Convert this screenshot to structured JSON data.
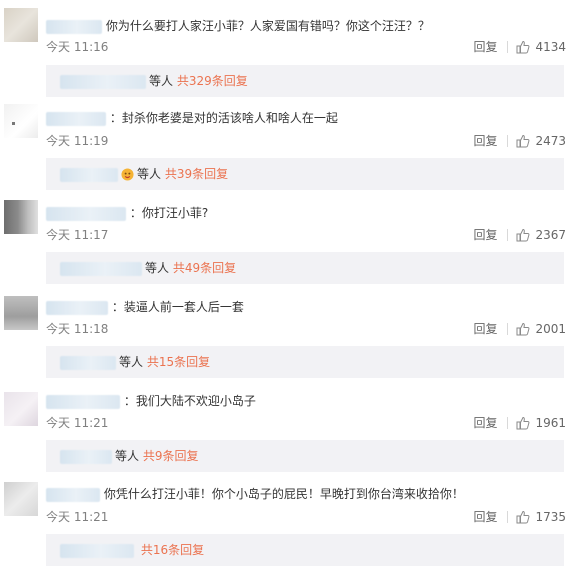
{
  "comments": [
    {
      "text": "你为什么要打人家汪小菲？人家爱国有错吗？你这个汪汪？？",
      "time": "今天 11:16",
      "reply_label": "回复",
      "likes": "4134",
      "sub_suffix": "等人",
      "sub_total": "共329条回复"
    },
    {
      "text": "：封杀你老婆是对的活该啥人和啥人在一起",
      "time": "今天 11:19",
      "reply_label": "回复",
      "likes": "2473",
      "sub_suffix": "等人",
      "sub_total": "共39条回复"
    },
    {
      "text": "：你打汪小菲?",
      "time": "今天 11:17",
      "reply_label": "回复",
      "likes": "2367",
      "sub_suffix": "等人",
      "sub_total": "共49条回复"
    },
    {
      "text": "：装逼人前一套人后一套",
      "time": "今天 11:18",
      "reply_label": "回复",
      "likes": "2001",
      "sub_suffix": "等人",
      "sub_total": "共15条回复"
    },
    {
      "text": "：我们大陆不欢迎小岛子",
      "time": "今天 11:21",
      "reply_label": "回复",
      "likes": "1961",
      "sub_suffix": "等人",
      "sub_total": "共9条回复"
    },
    {
      "text": "你凭什么打汪小菲！你个小岛子的屁民！早晚打到你台湾来收拾你！",
      "time": "今天 11:21",
      "reply_label": "回复",
      "likes": "1735",
      "sub_suffix": "",
      "sub_total": "共16条回复"
    }
  ],
  "colors": {
    "accent": "#eb7350",
    "meta": "#808080",
    "reply_bg": "#f2f2f5"
  },
  "icons": {
    "like": "thumbs-up-icon",
    "sub_reply_emoji": "face-emoji-icon"
  }
}
